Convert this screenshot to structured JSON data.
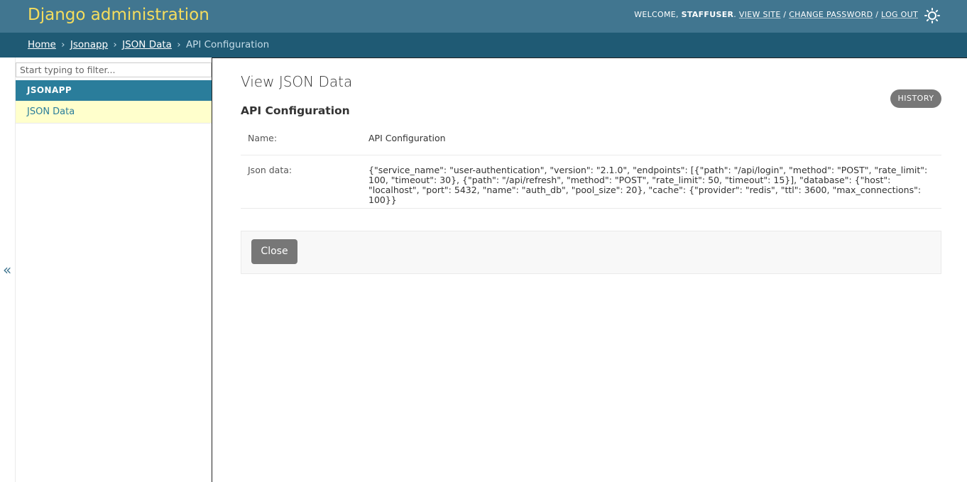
{
  "header": {
    "branding": "Django administration",
    "welcome_prefix": "Welcome,",
    "username": "staffuser",
    "view_site": "View site",
    "change_password": "Change password",
    "log_out": "Log out",
    "separator": "/",
    "theme_toggle_icon": "sun-icon"
  },
  "breadcrumbs": {
    "items": [
      "Home",
      "Jsonapp",
      "JSON Data"
    ],
    "current": "API Configuration",
    "separator": "›"
  },
  "sidebar": {
    "filter_placeholder": "Start typing to filter...",
    "app_caption": "JSONAPP",
    "models": [
      "JSON Data"
    ],
    "toggle_label": "«"
  },
  "content": {
    "title": "View JSON Data",
    "object_title": "API Configuration",
    "history_label": "HISTORY",
    "fields": {
      "name_label": "Name:",
      "name_value": "API Configuration",
      "json_label": "Json data:",
      "json_value": "{\"service_name\": \"user-authentication\", \"version\": \"2.1.0\", \"endpoints\": [{\"path\": \"/api/login\", \"method\": \"POST\", \"rate_limit\": 100, \"timeout\": 30}, {\"path\": \"/api/refresh\", \"method\": \"POST\", \"rate_limit\": 50, \"timeout\": 15}], \"database\": {\"host\": \"localhost\", \"port\": 5432, \"name\": \"auth_db\", \"pool_size\": 20}, \"cache\": {\"provider\": \"redis\", \"ttl\": 3600, \"max_connections\": 100}}"
    },
    "close_label": "Close"
  },
  "colors": {
    "header_bg": "#417690",
    "branding": "#f5dd5d",
    "breadcrumbs_bg": "#1f5a74",
    "accent": "#2a7d9b",
    "selected_row": "#ffffcc",
    "button_gray": "#777777"
  }
}
